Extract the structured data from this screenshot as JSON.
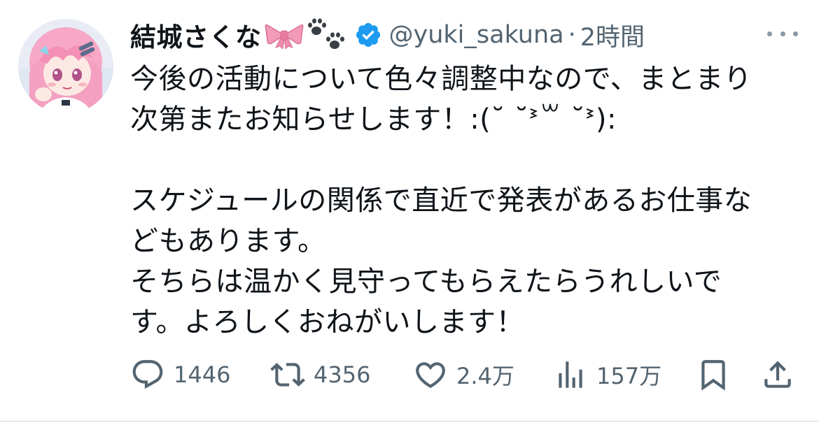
{
  "author": {
    "display_name": "結城さくな",
    "handle": "@yuki_sakuna",
    "separator": "·",
    "time": "2時間"
  },
  "tweet": {
    "text": "今後の活動について色々調整中なので、まとまり\n次第またお知らせします！:(˘ ˘ᕑ꒳ ˘ᕑ):\n\nスケジュールの関係で直近で発表があるお仕事な\nどもあります。\nそちらは温かく見守ってもらえたらうれしいで\nす。よろしくおねがいします！"
  },
  "actions": {
    "reply_count": "1446",
    "retweet_count": "4356",
    "like_count": "2.4万",
    "view_count": "157万"
  },
  "icons": {
    "avatar": "avatar-image",
    "bow": "ribbon-emoji",
    "paws": "paw-prints-emoji",
    "verified": "verified-badge-icon",
    "more": "more-icon",
    "reply": "reply-icon",
    "retweet": "retweet-icon",
    "like": "heart-icon",
    "views": "views-icon",
    "bookmark": "bookmark-icon",
    "share": "share-icon"
  },
  "colors": {
    "verified": "#1d9bf0",
    "muted": "#536471",
    "text": "#0f1419",
    "bow": "#f29ab8"
  }
}
